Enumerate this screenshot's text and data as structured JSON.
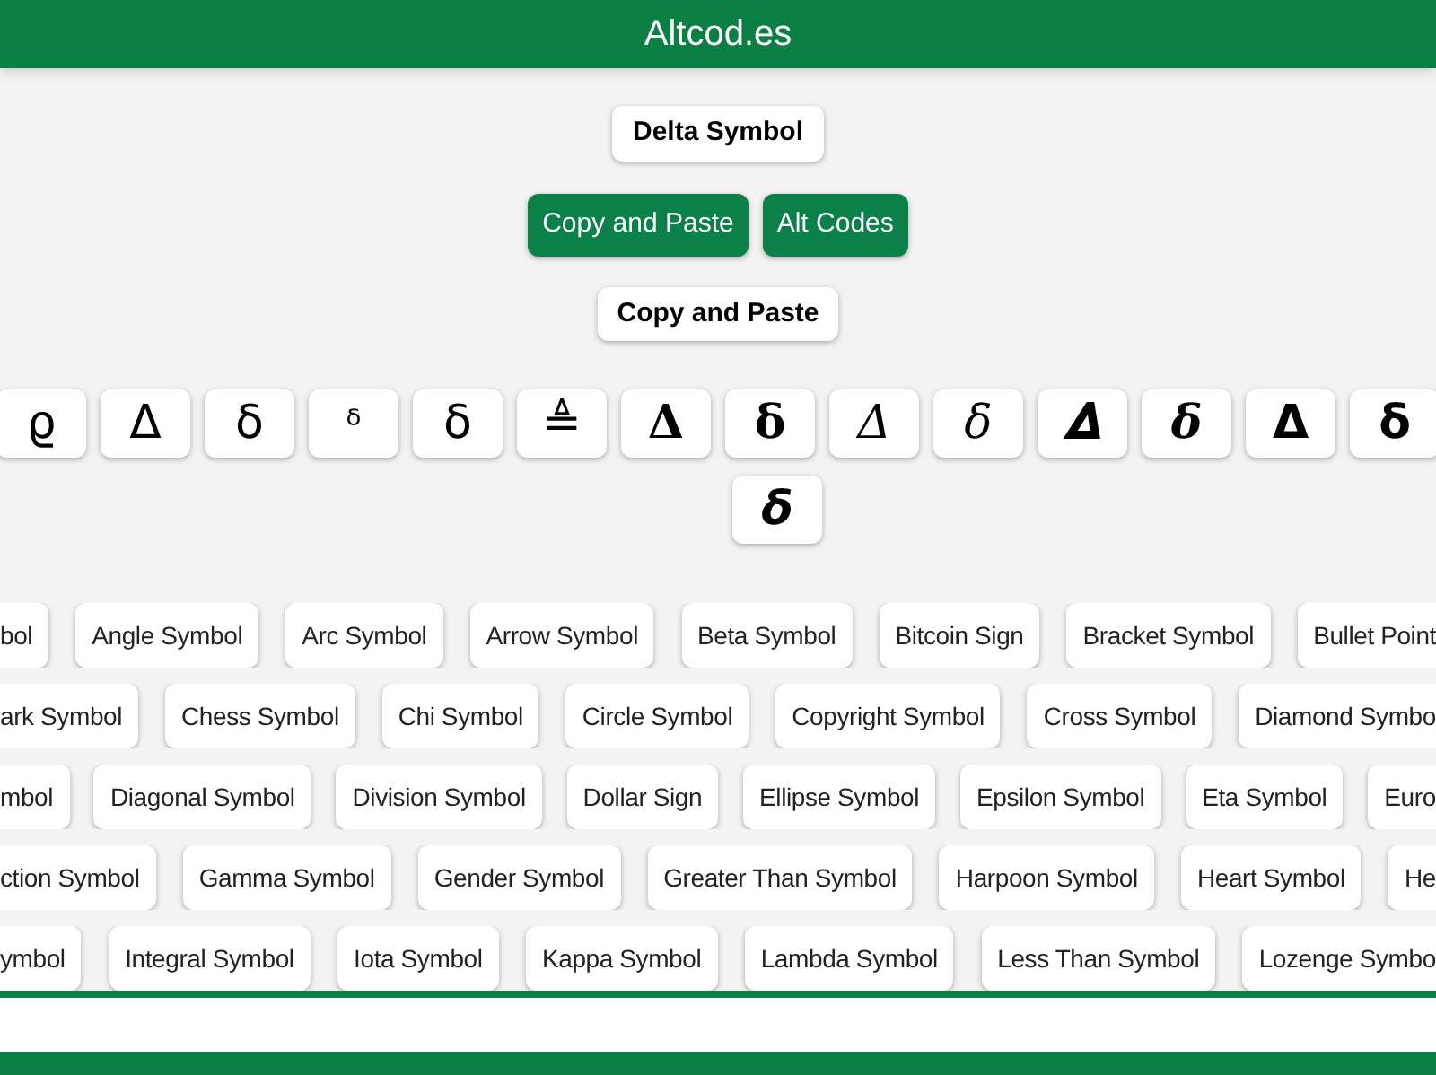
{
  "header": {
    "title": "Altcod.es"
  },
  "page_button": {
    "label": "Delta Symbol"
  },
  "nav_buttons": [
    {
      "label": "Copy and Paste"
    },
    {
      "label": "Alt Codes"
    }
  ],
  "section_button": {
    "label": "Copy and Paste"
  },
  "symbol_rows": [
    [
      {
        "symbol": "ϱ",
        "kind": "sans"
      },
      {
        "symbol": "Δ",
        "kind": "sans"
      },
      {
        "symbol": "δ",
        "kind": "sans"
      },
      {
        "symbol": "ᵟ",
        "kind": "small"
      },
      {
        "symbol": "δ",
        "kind": "sans"
      },
      {
        "symbol": "≜",
        "kind": "sans"
      },
      {
        "symbol": "𝚫",
        "kind": "serif-bold"
      },
      {
        "symbol": "𝛅",
        "kind": "serif-bold"
      },
      {
        "symbol": "𝛥",
        "kind": "serif-italic"
      },
      {
        "symbol": "𝛿",
        "kind": "serif-italic"
      },
      {
        "symbol": "𝜟",
        "kind": "serif-bold"
      },
      {
        "symbol": "𝜹",
        "kind": "serif-bold-italic"
      },
      {
        "symbol": "𝝙",
        "kind": "sans-bold"
      },
      {
        "symbol": "𝝳",
        "kind": "sans-bold"
      }
    ],
    [
      {
        "symbol": "𝞭",
        "kind": "sans-bold-italic"
      }
    ]
  ],
  "tag_rows": [
    [
      {
        "label": "bol",
        "kind": "cut-left"
      },
      {
        "label": "Angle Symbol",
        "kind": "whole"
      },
      {
        "label": "Arc Symbol",
        "kind": "whole"
      },
      {
        "label": "Arrow Symbol",
        "kind": "whole"
      },
      {
        "label": "Beta Symbol",
        "kind": "whole"
      },
      {
        "label": "Bitcoin Sign",
        "kind": "whole"
      },
      {
        "label": "Bracket Symbol",
        "kind": "whole"
      },
      {
        "label": "Bullet Point",
        "kind": "cut-right"
      }
    ],
    [
      {
        "label": "ark Symbol",
        "kind": "cut-left"
      },
      {
        "label": "Chess Symbol",
        "kind": "whole"
      },
      {
        "label": "Chi Symbol",
        "kind": "whole"
      },
      {
        "label": "Circle Symbol",
        "kind": "whole"
      },
      {
        "label": "Copyright Symbol",
        "kind": "whole"
      },
      {
        "label": "Cross Symbol",
        "kind": "whole"
      },
      {
        "label": "Diamond Symbo",
        "kind": "cut-right"
      }
    ],
    [
      {
        "label": "mbol",
        "kind": "cut-left"
      },
      {
        "label": "Diagonal Symbol",
        "kind": "whole"
      },
      {
        "label": "Division Symbol",
        "kind": "whole"
      },
      {
        "label": "Dollar Sign",
        "kind": "whole"
      },
      {
        "label": "Ellipse Symbol",
        "kind": "whole"
      },
      {
        "label": "Epsilon Symbol",
        "kind": "whole"
      },
      {
        "label": "Eta Symbol",
        "kind": "whole"
      },
      {
        "label": "Euro",
        "kind": "cut-right"
      }
    ],
    [
      {
        "label": "ction Symbol",
        "kind": "cut-left"
      },
      {
        "label": "Gamma Symbol",
        "kind": "whole"
      },
      {
        "label": "Gender Symbol",
        "kind": "whole"
      },
      {
        "label": "Greater Than Symbol",
        "kind": "whole"
      },
      {
        "label": "Harpoon Symbol",
        "kind": "whole"
      },
      {
        "label": "Heart Symbol",
        "kind": "whole"
      },
      {
        "label": "He",
        "kind": "cut-right"
      }
    ],
    [
      {
        "label": "ymbol",
        "kind": "cut-left"
      },
      {
        "label": "Integral Symbol",
        "kind": "whole"
      },
      {
        "label": "Iota Symbol",
        "kind": "whole"
      },
      {
        "label": "Kappa Symbol",
        "kind": "whole"
      },
      {
        "label": "Lambda Symbol",
        "kind": "whole"
      },
      {
        "label": "Less Than Symbol",
        "kind": "whole"
      },
      {
        "label": "Lozenge Symbo",
        "kind": "cut-right"
      }
    ]
  ]
}
